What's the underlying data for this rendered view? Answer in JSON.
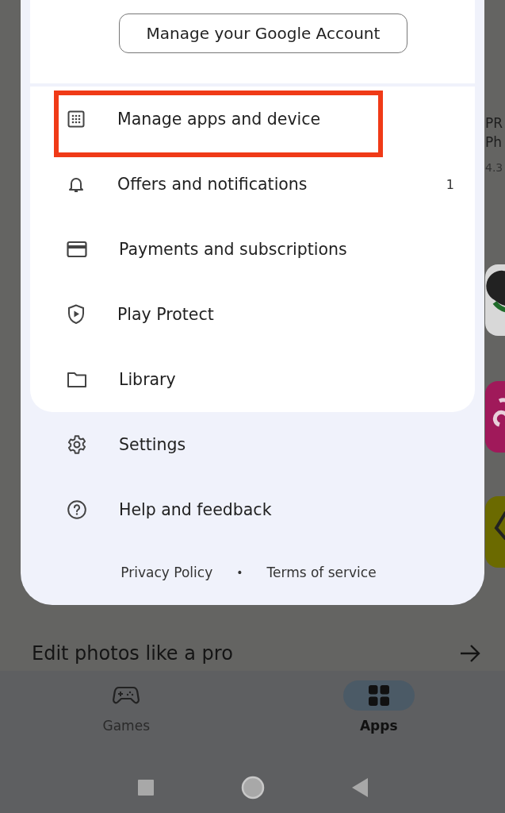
{
  "account_button": "Manage your Google Account",
  "menu_items": [
    {
      "label": "Manage apps and device",
      "highlighted": true
    },
    {
      "label": "Offers and notifications",
      "highlighted": false,
      "count": "1"
    },
    {
      "label": "Payments and subscriptions",
      "highlighted": false
    },
    {
      "label": "Play Protect",
      "highlighted": false
    },
    {
      "label": "Library",
      "highlighted": false
    }
  ],
  "secondary_items": [
    {
      "label": "Settings"
    },
    {
      "label": "Help and feedback"
    }
  ],
  "footer": {
    "links": [
      "Privacy Policy",
      "Terms of service"
    ],
    "separator": "•"
  },
  "background": {
    "peek_texts": [
      "PR",
      "Ph",
      "4.3"
    ],
    "section_title": "Edit photos like a pro"
  },
  "bottom_nav": [
    {
      "label": "Games",
      "selected": false
    },
    {
      "label": "Apps",
      "selected": true
    }
  ]
}
